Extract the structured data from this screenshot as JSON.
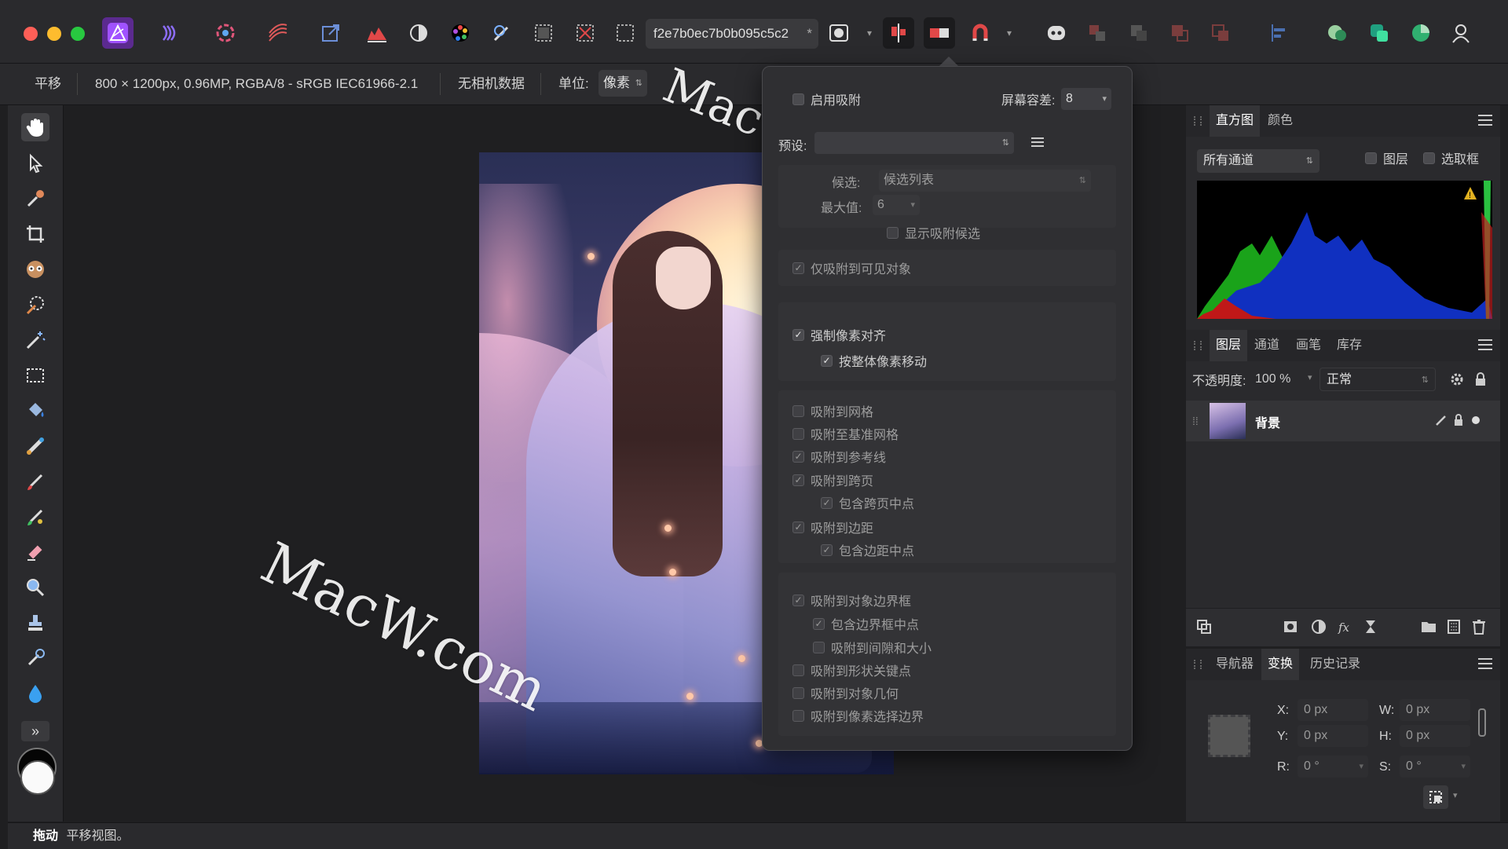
{
  "toolbar": {
    "doc_tab_title": "f2e7b0ec7b0b095c5c2",
    "doc_tab_modified": "*"
  },
  "context": {
    "tool_name": "平移",
    "doc_info": "800 × 1200px, 0.96MP, RGBA/8 - sRGB IEC61966-2.1",
    "camera_data": "无相机数据",
    "units_label": "单位:",
    "units_value": "像素"
  },
  "snapping": {
    "enable_label": "启用吸附",
    "tolerance_label": "屏幕容差:",
    "tolerance_value": "8",
    "preset_label": "预设:",
    "preset_value": "",
    "candidates_label": "候选:",
    "candidates_value": "候选列表",
    "max_label": "最大值:",
    "max_value": "6",
    "show_candidates": "显示吸附候选",
    "visible_only": "仅吸附到可见对象",
    "force_pixel": "强制像素对齐",
    "whole_pixel_move": "按整体像素移动",
    "to_grid": "吸附到网格",
    "to_baseline": "吸附至基准网格",
    "to_guides": "吸附到参考线",
    "to_spreads": "吸附到跨页",
    "spread_mid": "包含跨页中点",
    "to_margins": "吸附到边距",
    "margin_mid": "包含边距中点",
    "to_bbox": "吸附到对象边界框",
    "bbox_mid": "包含边界框中点",
    "gap_size": "吸附到间隙和大小",
    "shape_keys": "吸附到形状关键点",
    "object_geom": "吸附到对象几何",
    "pixel_sel": "吸附到像素选择边界"
  },
  "histogram": {
    "tab_histogram": "直方图",
    "tab_color": "颜色",
    "channel_select": "所有通道",
    "layer_check": "图层",
    "marquee_check": "选取框"
  },
  "layers": {
    "tab_layers": "图层",
    "tab_channels": "通道",
    "tab_brushes": "画笔",
    "tab_stock": "库存",
    "opacity_label": "不透明度:",
    "opacity_value": "100 %",
    "blend_mode": "正常",
    "layer_name": "背景"
  },
  "transform": {
    "tab_navigator": "导航器",
    "tab_transform": "变换",
    "tab_history": "历史记录",
    "x_label": "X:",
    "x_value": "0 px",
    "y_label": "Y:",
    "y_value": "0 px",
    "w_label": "W:",
    "w_value": "0 px",
    "h_label": "H:",
    "h_value": "0 px",
    "r_label": "R:",
    "r_value": "0 °",
    "s_label": "S:",
    "s_value": "0 °"
  },
  "status": {
    "action": "拖动",
    "hint": "平移视图。"
  },
  "watermark_text": "MacW.com",
  "colors": {
    "accent": "#8a4dd6",
    "traffic_red": "#fe5f57",
    "traffic_yellow": "#febc2e",
    "traffic_green": "#28c840"
  }
}
